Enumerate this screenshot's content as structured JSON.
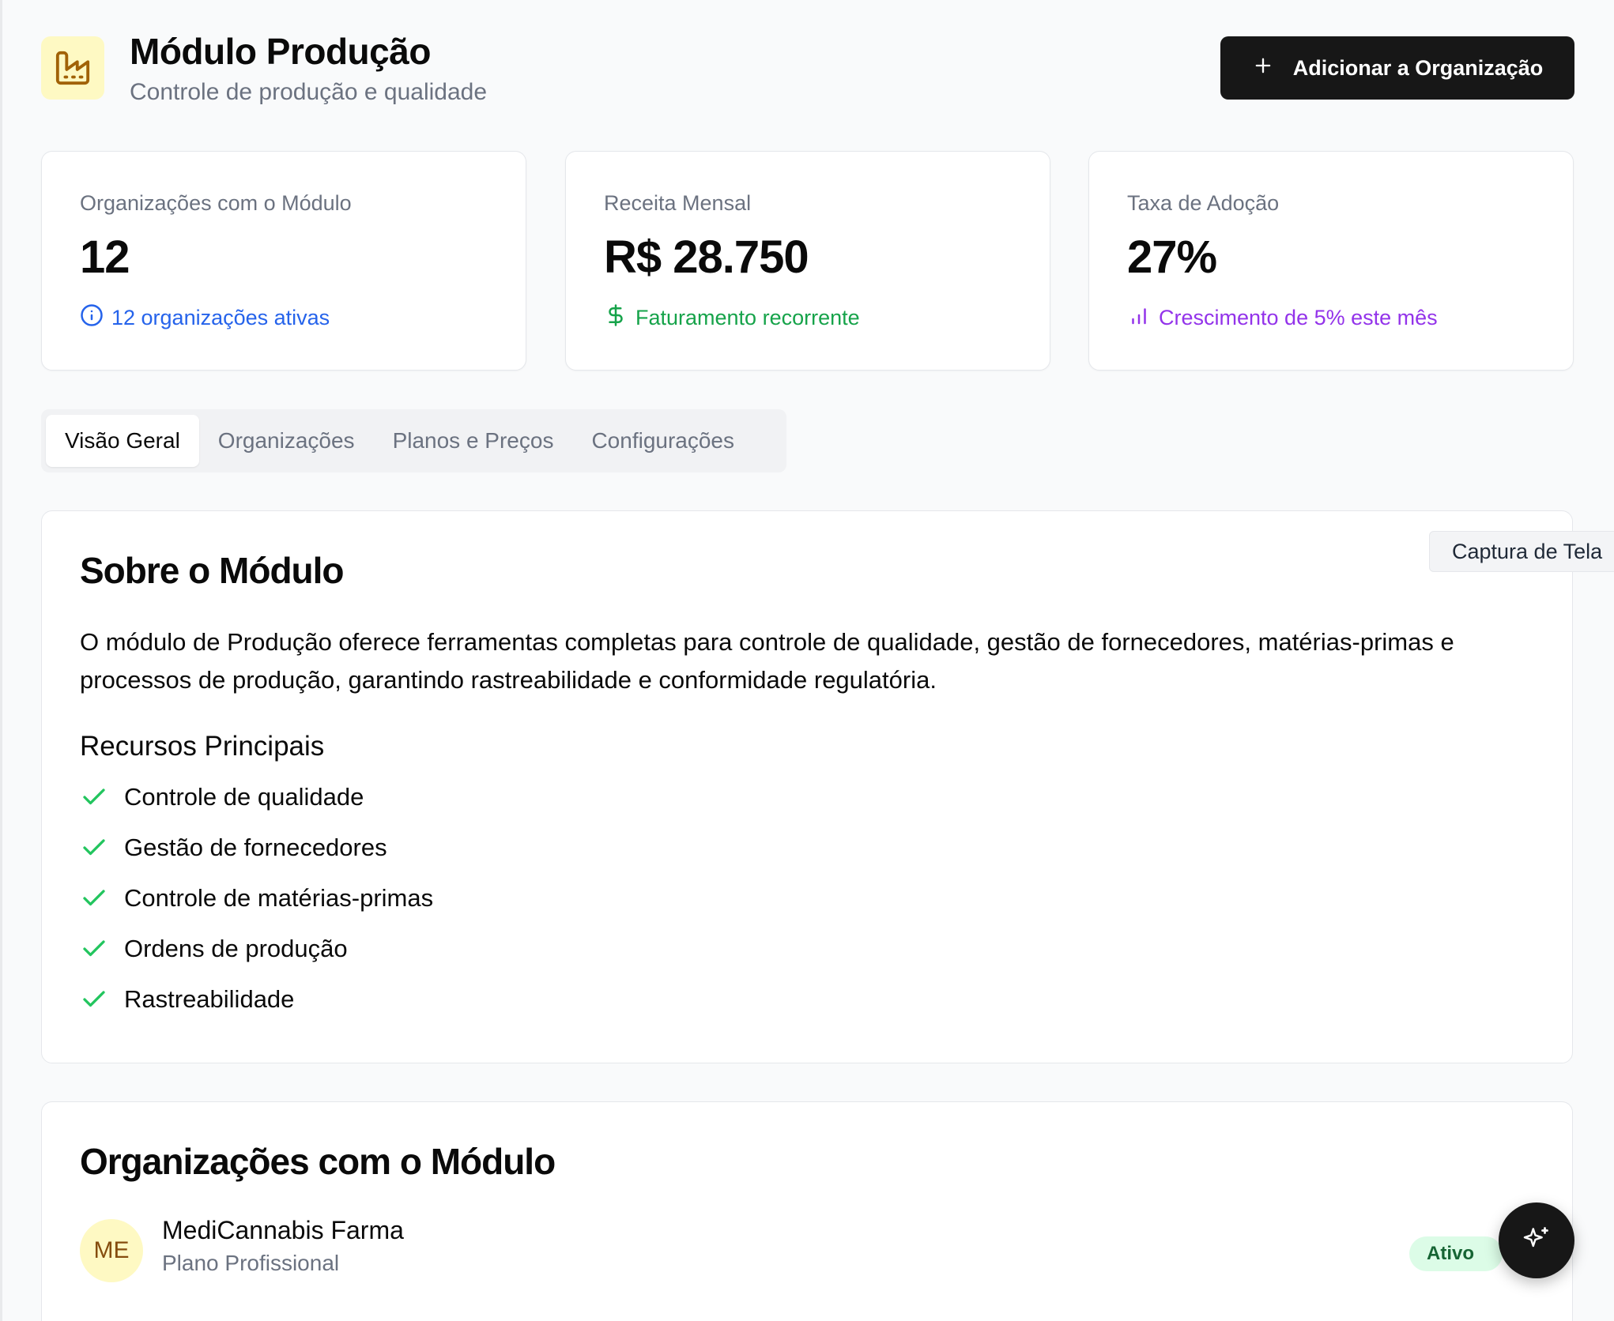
{
  "header": {
    "icon": "factory-icon",
    "title": "Módulo Produção",
    "subtitle": "Controle de produção e qualidade",
    "add_button_label": "Adicionar a Organização"
  },
  "stats": [
    {
      "label": "Organizações com o Módulo",
      "value": "12",
      "note": "12 organizações ativas",
      "icon": "info-icon",
      "color": "#2563eb"
    },
    {
      "label": "Receita Mensal",
      "value": "R$ 28.750",
      "note": "Faturamento recorrente",
      "icon": "dollar-icon",
      "color": "#16a34a"
    },
    {
      "label": "Taxa de Adoção",
      "value": "27%",
      "note": "Crescimento de 5% este mês",
      "icon": "bar-chart-icon",
      "color": "#9333ea"
    }
  ],
  "tabs": [
    {
      "label": "Visão Geral",
      "active": true
    },
    {
      "label": "Organizações",
      "active": false
    },
    {
      "label": "Planos e Preços",
      "active": false
    },
    {
      "label": "Configurações",
      "active": false
    }
  ],
  "about": {
    "title": "Sobre o Módulo",
    "description": "O módulo de Produção oferece ferramentas completas para controle de qualidade, gestão de fornecedores, matérias-primas e processos de produção, garantindo rastreabilidade e conformidade regulatória.",
    "features_title": "Recursos Principais",
    "features": [
      "Controle de qualidade",
      "Gestão de fornecedores",
      "Controle de matérias-primas",
      "Ordens de produção",
      "Rastreabilidade"
    ]
  },
  "organizations": {
    "title": "Organizações com o Módulo",
    "items": [
      {
        "initials": "ME",
        "name": "MediCannabis Farma",
        "plan": "Plano Profissional",
        "status": "Ativo"
      }
    ]
  },
  "tooltip": "Captura de Tela",
  "ai_button_icon": "sparkles-icon",
  "colors": {
    "accent": "#171717",
    "check": "#22c55e",
    "icon_bg": "#fef9c3",
    "icon_fg": "#a16207"
  }
}
